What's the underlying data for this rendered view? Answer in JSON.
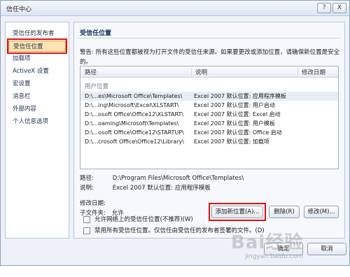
{
  "window": {
    "title": "信任中心",
    "help_glyph": "?",
    "close_glyph": "X"
  },
  "sidebar": {
    "items": [
      {
        "label": "受信任的发布者"
      },
      {
        "label": "受信任位置"
      },
      {
        "label": "加载项"
      },
      {
        "label": "ActiveX 设置"
      },
      {
        "label": "宏设置"
      },
      {
        "label": "消息栏"
      },
      {
        "label": "外部内容"
      },
      {
        "label": "个人信息选项"
      }
    ],
    "selected_index": 1
  },
  "main": {
    "section_title": "受信任位置",
    "warning": "警告: 所有这些位置都被视为打开文件的受信任来源。如果要更改或添加位置，请确保新位置是安全的。",
    "table": {
      "headers": {
        "path": "路径",
        "desc": "说明",
        "date": "修改日期"
      },
      "group_label": "用户位置",
      "rows": [
        {
          "path": "D:\\...es\\Microsoft Office\\Templates\\",
          "desc": "Excel 2007 默认位置: 应用程序模板"
        },
        {
          "path": "D:\\...ing\\Microsoft\\Excel\\XLSTART\\",
          "desc": "Excel 2007 默认位置: 用户启动"
        },
        {
          "path": "D:\\...osoft Office\\Office12\\XLSTART\\",
          "desc": "Excel 2007 默认位置: Excel 启动"
        },
        {
          "path": "D:\\...oaming\\Microsoft\\Templates\\",
          "desc": "Excel 2007 默认位置: 用户模板"
        },
        {
          "path": "D:\\...osoft Office\\Office12\\STARTUP\\",
          "desc": "Excel 2007 默认位置: Office 启动"
        },
        {
          "path": "D:\\...crosoft Office\\Office12\\Library\\",
          "desc": "Excel 2007 默认位置: 加载项"
        }
      ]
    },
    "details": {
      "path_label": "路径:",
      "path_value": "D:\\Program Files\\Microsoft Office\\Templates\\",
      "desc_label": "说明:",
      "desc_value": "Excel 2007 默认位置: 应用程序模板",
      "date_label": "修改日期:",
      "subfolder_label": "子文件夹:",
      "subfolder_value": "允许"
    },
    "buttons": {
      "add": "添加新位置(A)...",
      "remove": "删除(R)",
      "modify": "修改(M)..."
    },
    "checkboxes": [
      {
        "label": "允许网络上的受信任位置(不推荐)(W)"
      },
      {
        "label": "禁用所有受信任位置。仅信任由受信任的发布者签署的文件。(D)"
      }
    ]
  },
  "footer": {
    "ok": "确定",
    "cancel": "取消"
  },
  "watermark": {
    "text": "Bai经验",
    "url": "jingyan.baidu.com"
  },
  "colors": {
    "highlight_red": "#e01010",
    "selection": "#fbe3b2",
    "accent": "#1f3b6b"
  }
}
